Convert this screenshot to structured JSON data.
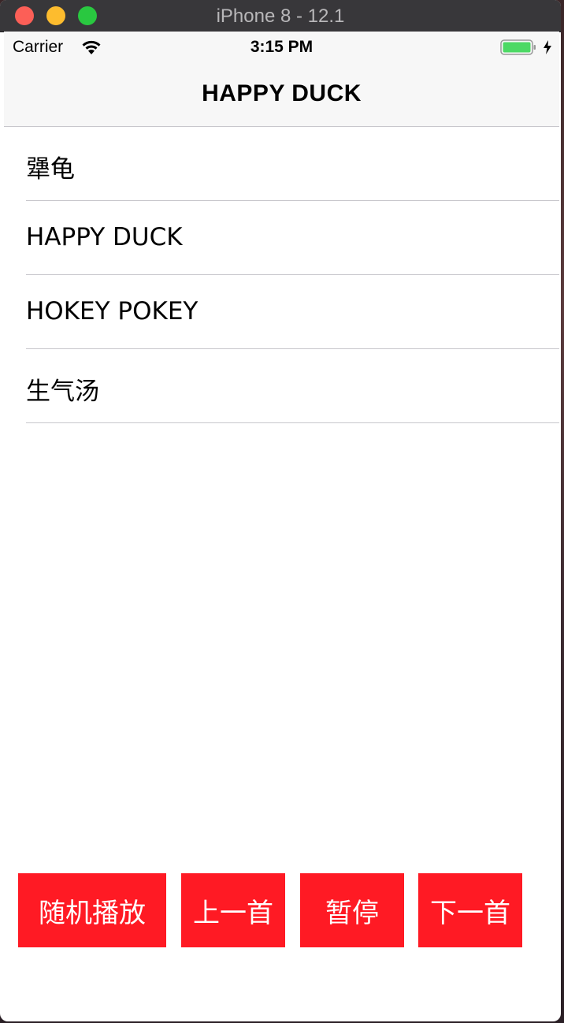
{
  "window": {
    "title": "iPhone 8 - 12.1"
  },
  "status_bar": {
    "carrier": "Carrier",
    "time": "3:15 PM",
    "battery_color": "#4cd964"
  },
  "nav": {
    "title": "HAPPY DUCK"
  },
  "songs": [
    {
      "label": "犟龟"
    },
    {
      "label": "HAPPY DUCK"
    },
    {
      "label": "HOKEY POKEY"
    },
    {
      "label": "生气汤"
    }
  ],
  "controls": {
    "shuffle": "随机播放",
    "previous": "上一首",
    "pause": "暂停",
    "next": "下一首",
    "color": "#ff1a24"
  }
}
